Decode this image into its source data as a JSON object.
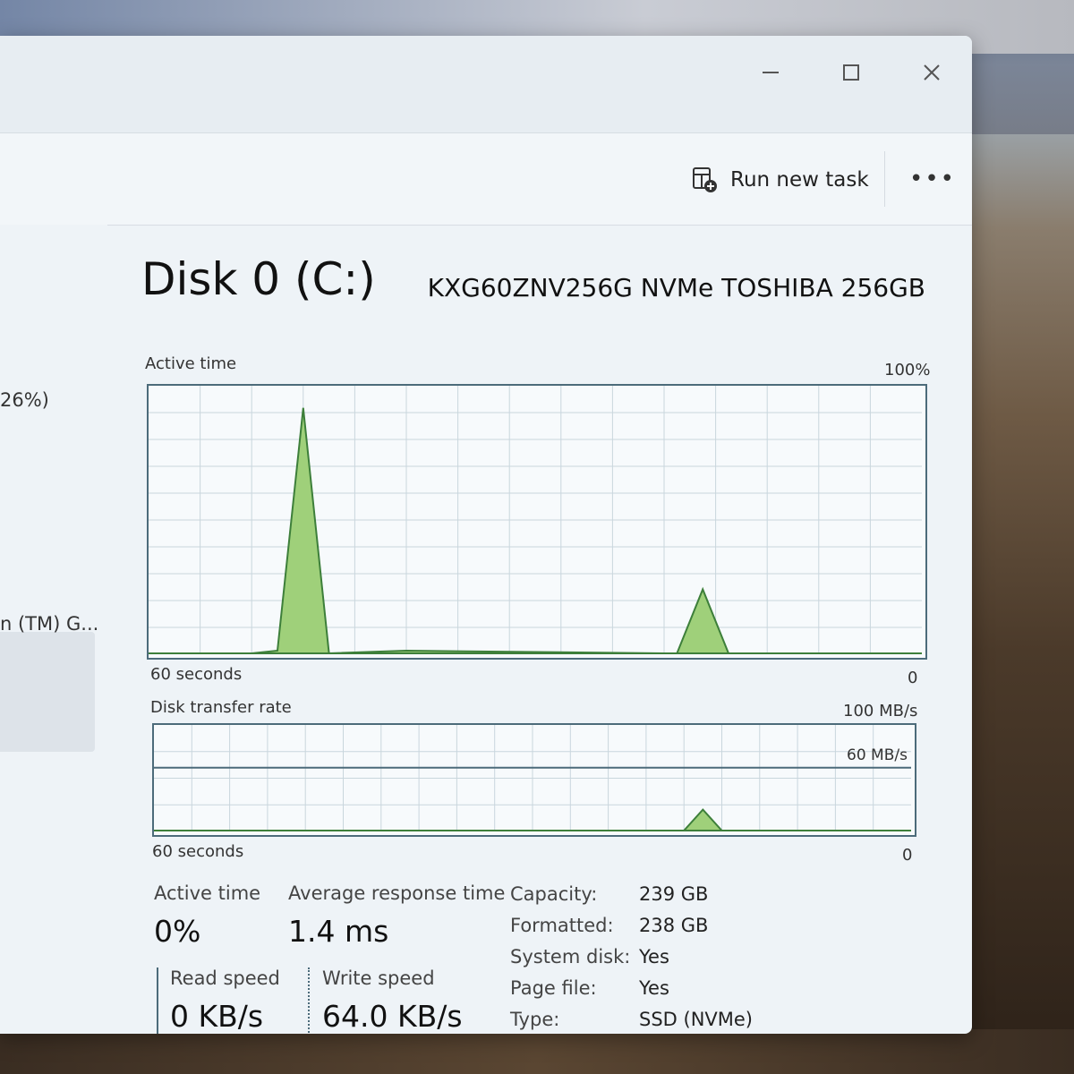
{
  "toolbar": {
    "run_task_label": "Run new task",
    "more_label": "•••"
  },
  "sidebar": {
    "item1": "26%)",
    "item2": "n (TM) G..."
  },
  "disk": {
    "title": "Disk 0 (C:)",
    "model": "KXG60ZNV256G NVMe TOSHIBA 256GB"
  },
  "active_chart": {
    "label": "Active time",
    "max_label": "100%",
    "time_label": "60 seconds",
    "min_label": "0"
  },
  "transfer_chart": {
    "label": "Disk transfer rate",
    "max_label": "100 MB/s",
    "line_label": "60 MB/s",
    "time_label": "60 seconds",
    "min_label": "0"
  },
  "stats": {
    "active_time_label": "Active time",
    "active_time_value": "0%",
    "response_label": "Average response time",
    "response_value": "1.4 ms",
    "read_label": "Read speed",
    "read_value": "0 KB/s",
    "write_label": "Write speed",
    "write_value": "64.0 KB/s"
  },
  "info": [
    {
      "label": "Capacity:",
      "value": "239 GB"
    },
    {
      "label": "Formatted:",
      "value": "238 GB"
    },
    {
      "label": "System disk:",
      "value": "Yes"
    },
    {
      "label": "Page file:",
      "value": "Yes"
    },
    {
      "label": "Type:",
      "value": "SSD (NVMe)"
    }
  ],
  "chart_data": [
    {
      "type": "area",
      "title": "Active time",
      "xlabel": "60 seconds",
      "ylim": [
        0,
        100
      ],
      "x": [
        0,
        8,
        10,
        12,
        14,
        20,
        40,
        41,
        43,
        45,
        47,
        60
      ],
      "values": [
        0,
        0,
        1,
        92,
        0,
        1,
        0,
        0,
        24,
        0,
        0,
        0
      ],
      "grid": true,
      "colors": {
        "fill": "#9fd07a",
        "stroke": "#3d7f3a"
      }
    },
    {
      "type": "area",
      "title": "Disk transfer rate",
      "xlabel": "60 seconds",
      "ylim": [
        0,
        100
      ],
      "x": [
        0,
        40,
        42,
        43.5,
        45,
        60
      ],
      "values": [
        0,
        0,
        0,
        20,
        0,
        0
      ],
      "reference_line": 60,
      "grid": true,
      "colors": {
        "fill": "#9fd07a",
        "stroke": "#3d7f3a"
      }
    }
  ]
}
